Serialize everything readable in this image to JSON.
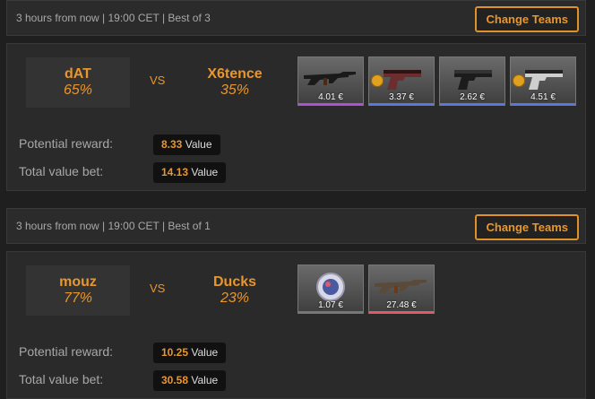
{
  "matches": [
    {
      "info": "3 hours from now | 19:00 CET | Best of 3",
      "change_label": "Change Teams",
      "team1": {
        "name": "dAT",
        "pct": "65%"
      },
      "vs": "VS",
      "team2": {
        "name": "X6tence",
        "pct": "35%"
      },
      "items": [
        {
          "price": "4.01 €",
          "icon": "rifle-icon",
          "rarity_color": "#b14fd6",
          "sticker": false
        },
        {
          "price": "3.37 €",
          "icon": "pistol-icon",
          "rarity_color": "#5b78d6",
          "sticker": true
        },
        {
          "price": "2.62 €",
          "icon": "pistol-icon",
          "rarity_color": "#5b78d6",
          "sticker": false
        },
        {
          "price": "4.51 €",
          "icon": "pistol-icon",
          "rarity_color": "#5b78d6",
          "sticker": true
        }
      ],
      "potential_label": "Potential reward:",
      "potential_value": "8.33",
      "total_label": "Total value bet:",
      "total_value": "14.13",
      "value_word": "Value"
    },
    {
      "info": "3 hours from now | 19:00 CET | Best of 1",
      "change_label": "Change Teams",
      "team1": {
        "name": "mouz",
        "pct": "77%"
      },
      "vs": "VS",
      "team2": {
        "name": "Ducks",
        "pct": "23%"
      },
      "items": [
        {
          "price": "1.07 €",
          "icon": "sticker-capsule-icon",
          "rarity_color": "#777777",
          "sticker": false
        },
        {
          "price": "27.48 €",
          "icon": "rifle-icon",
          "rarity_color": "#e05a6a",
          "sticker": false
        }
      ],
      "potential_label": "Potential reward:",
      "potential_value": "10.25",
      "total_label": "Total value bet:",
      "total_value": "30.58",
      "value_word": "Value"
    }
  ],
  "colors": {
    "accent": "#e8962d",
    "background": "#1f1f1f"
  }
}
